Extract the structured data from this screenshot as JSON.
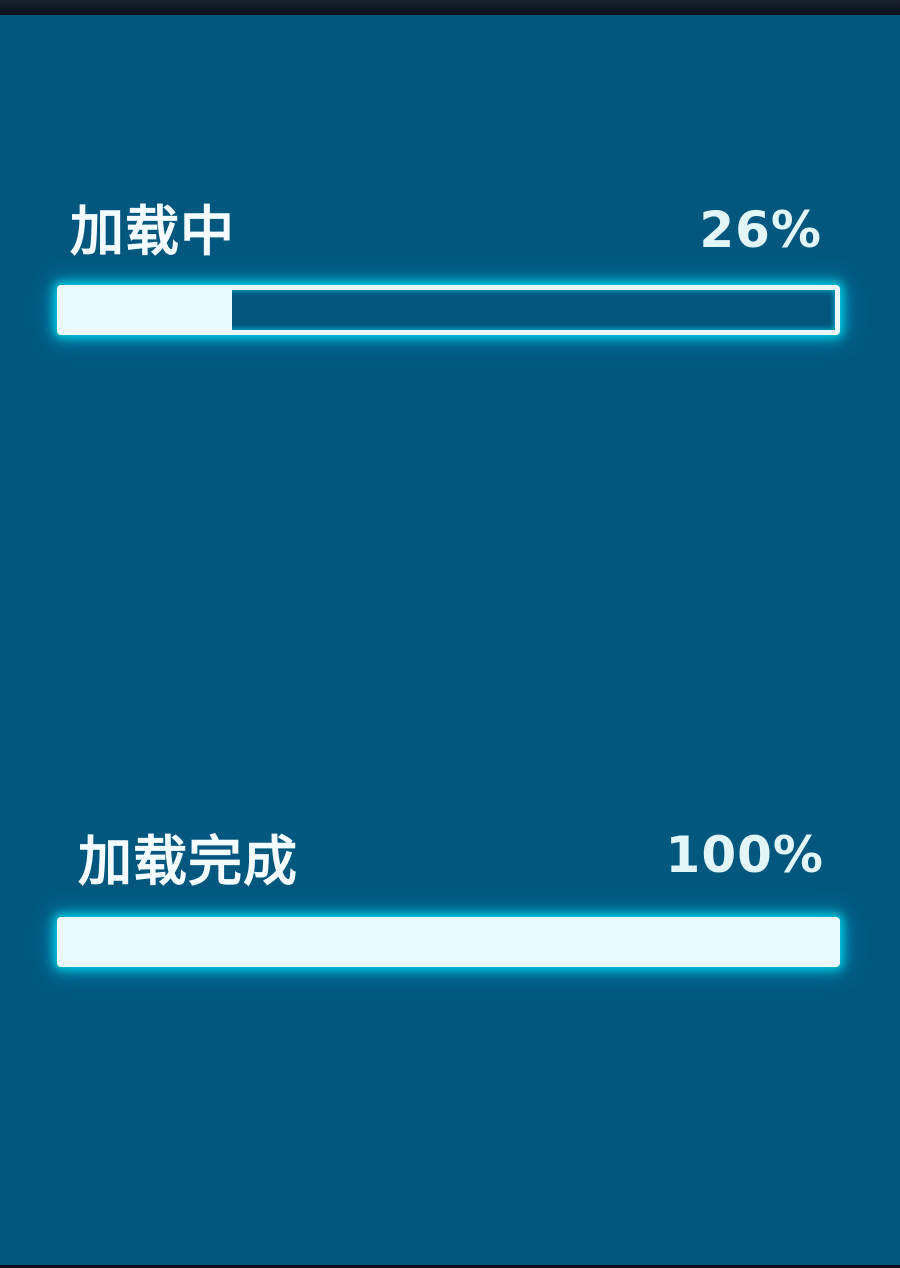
{
  "progress_loading": {
    "label": "加载中",
    "percent_text": "26%",
    "value": 0.22
  },
  "progress_complete": {
    "label": "加载完成",
    "percent_text": "100%",
    "value": 1.0
  },
  "colors": {
    "background": "#02577f",
    "bar_fill": "#eafcff",
    "glow": "#00f0ff",
    "text": "#f4fcff"
  }
}
